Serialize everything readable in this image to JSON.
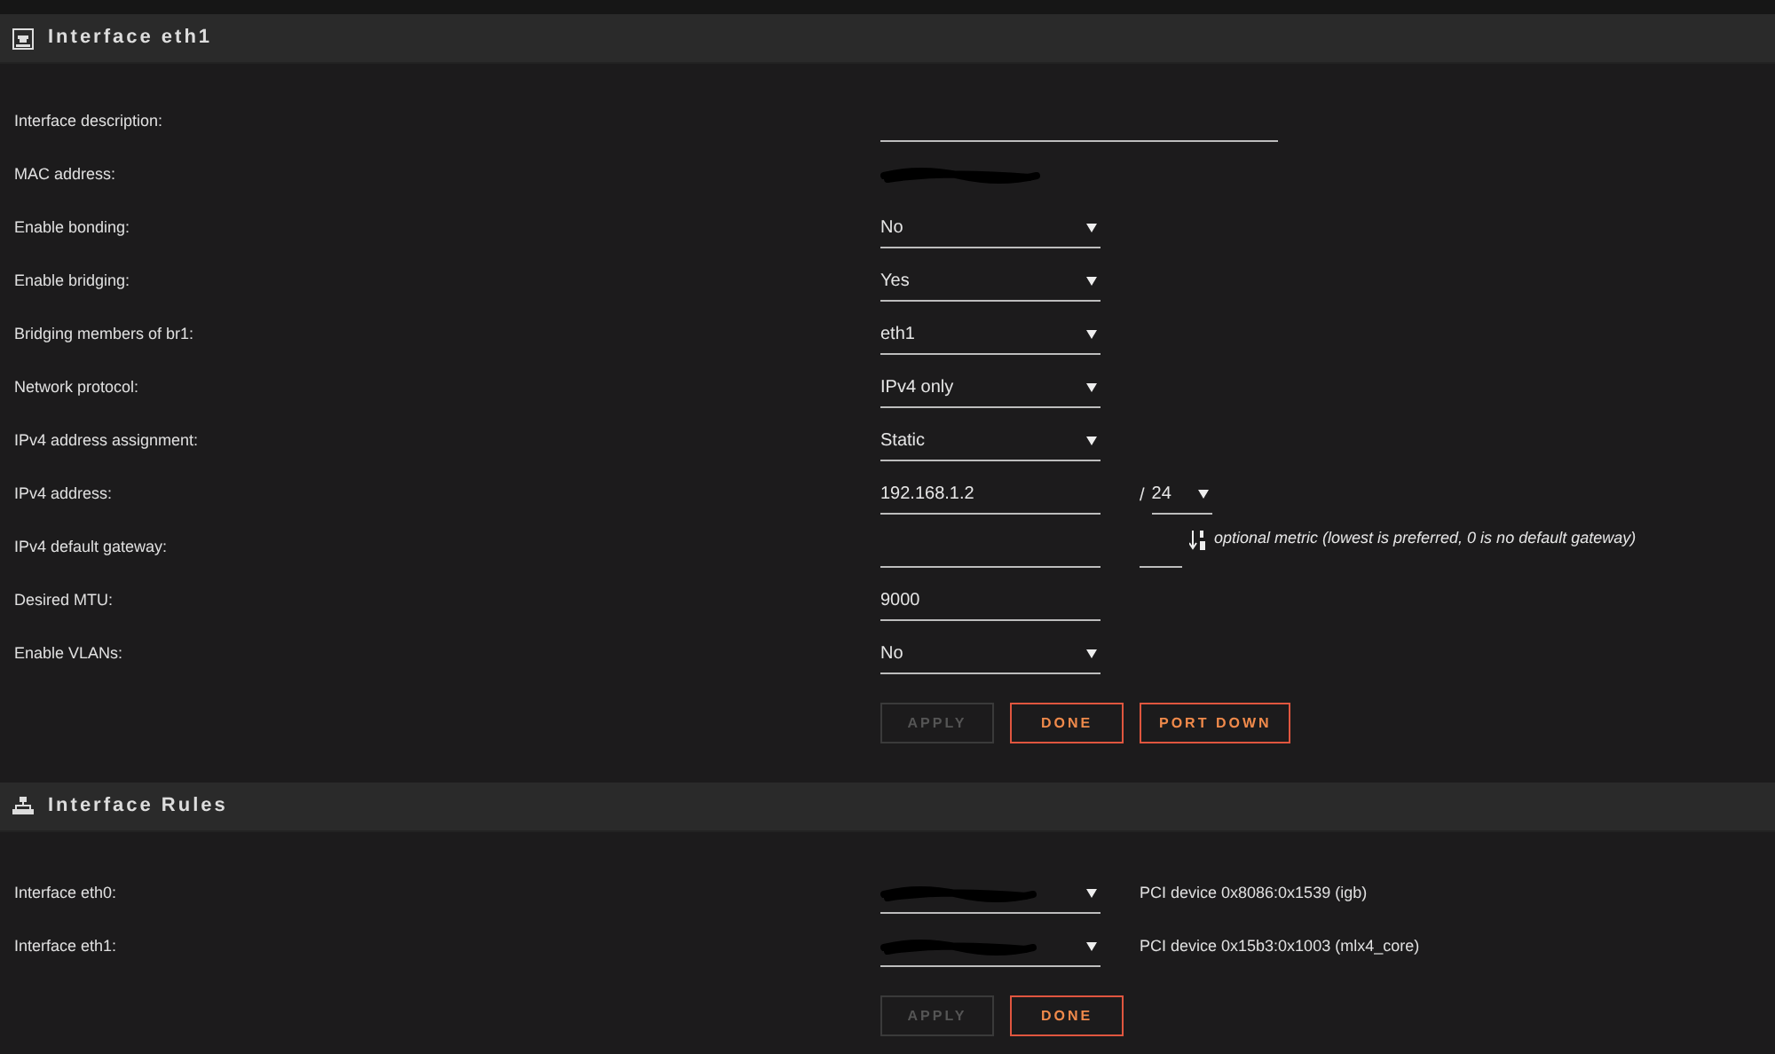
{
  "sections": [
    {
      "title": "Interface eth1",
      "rows": [
        {
          "label": "Interface description:",
          "kind": "text_wide",
          "value": ""
        },
        {
          "label": "MAC address:",
          "kind": "masked"
        },
        {
          "label": "Enable bonding:",
          "kind": "select",
          "value": "No"
        },
        {
          "label": "Enable bridging:",
          "kind": "select",
          "value": "Yes"
        },
        {
          "label": "Bridging members of br1:",
          "kind": "select",
          "value": "eth1"
        },
        {
          "label": "Network protocol:",
          "kind": "select",
          "value": "IPv4 only"
        },
        {
          "label": "IPv4 address assignment:",
          "kind": "select",
          "value": "Static"
        },
        {
          "label": "IPv4 address:",
          "kind": "address",
          "value": "192.168.1.2",
          "separator": "/",
          "prefix": "24"
        },
        {
          "label": "IPv4 default gateway:",
          "kind": "gateway",
          "value": "",
          "hint": "optional metric (lowest is preferred, 0 is no default gateway)"
        },
        {
          "label": "Desired MTU:",
          "kind": "text",
          "value": "9000"
        },
        {
          "label": "Enable VLANs:",
          "kind": "select",
          "value": "No"
        }
      ],
      "buttons": [
        {
          "label": "APPLY",
          "disabled": true
        },
        {
          "label": "DONE",
          "disabled": false
        },
        {
          "label": "PORT DOWN",
          "disabled": false
        }
      ]
    },
    {
      "title": "Interface Rules",
      "rows": [
        {
          "label": "Interface eth0:",
          "kind": "masked_select",
          "info": "PCI device 0x8086:0x1539 (igb)"
        },
        {
          "label": "Interface eth1:",
          "kind": "masked_select",
          "info": "PCI device 0x15b3:0x1003 (mlx4_core)"
        }
      ],
      "buttons": [
        {
          "label": "APPLY",
          "disabled": true
        },
        {
          "label": "DONE",
          "disabled": false
        }
      ]
    }
  ]
}
